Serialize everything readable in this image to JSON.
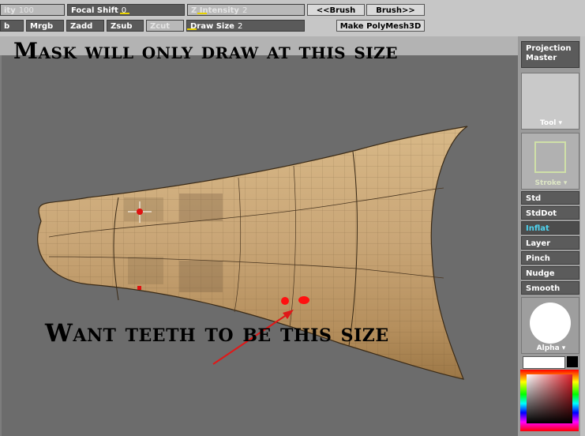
{
  "toolbar": {
    "row1": {
      "intensity_left": {
        "label": "ity",
        "value": "100"
      },
      "focal_shift": {
        "label": "Focal Shift",
        "value": "0"
      },
      "z_intensity": {
        "label": "Z Intensity",
        "value": "2"
      },
      "prev_brush": "<<Brush",
      "next_brush": "Brush>>"
    },
    "row2": {
      "rgb": "b",
      "mrgb": "Mrgb",
      "zadd": "Zadd",
      "zsub": "Zsub",
      "zcut": "Zcut",
      "draw_size": {
        "label": "Draw Size",
        "value": "2"
      },
      "make_polymesh": "Make PolyMesh3D"
    }
  },
  "canvas": {
    "caption_top": "Mask will only draw at this size",
    "caption_bottom": "Want teeth to be this size"
  },
  "right_panel": {
    "projection_master": "Projection Master",
    "tool_label": "Tool",
    "stroke_label": "Stroke",
    "alpha_label": "Alpha",
    "brushes": [
      {
        "label": "Std",
        "active": false
      },
      {
        "label": "StdDot",
        "active": false
      },
      {
        "label": "Inflat",
        "active": true
      },
      {
        "label": "Layer",
        "active": false
      },
      {
        "label": "Pinch",
        "active": false
      },
      {
        "label": "Nudge",
        "active": false
      },
      {
        "label": "Smooth",
        "active": false
      }
    ]
  },
  "colors": {
    "mesh_fill": "#c9a677",
    "mask_dot": "#ff1010",
    "arrow": "#e01818",
    "active_brush": "#4fd4f0",
    "slider_indicator": "#e8d200"
  }
}
